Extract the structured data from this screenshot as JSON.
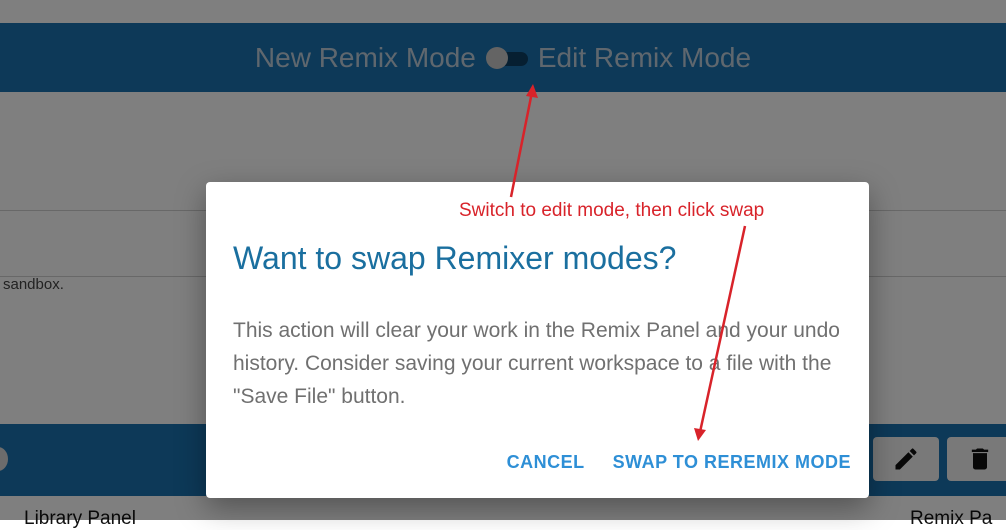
{
  "header": {
    "new_mode_label": "New Remix Mode",
    "edit_mode_label": "Edit Remix Mode"
  },
  "background": {
    "sandbox_text": "sandbox.",
    "library_panel_label": "Library Panel",
    "remix_panel_label": "Remix Pa"
  },
  "dialog": {
    "title": "Want to swap Remixer modes?",
    "body": "This action will clear your work in the Remix Panel and your undo history. Consider saving your current workspace to a file with the \"Save File\" button.",
    "cancel_label": "CANCEL",
    "swap_label": "SWAP TO REREMIX MODE"
  },
  "annotation": {
    "text": "Switch to edit mode, then click swap"
  },
  "colors": {
    "header_blue": "#1a73b0",
    "title_blue": "#1a6f9f",
    "button_blue": "#2e8fd6",
    "annotation_red": "#d8232a"
  }
}
